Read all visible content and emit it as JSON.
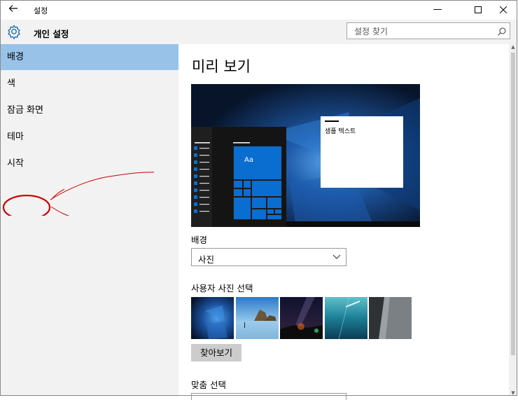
{
  "window": {
    "title": "설정",
    "controls": {
      "minimize": "—",
      "maximize": "☐",
      "close": "✕"
    }
  },
  "header": {
    "section_title": "개인 설정",
    "search_placeholder": "설정 찾기"
  },
  "sidebar": {
    "items": [
      {
        "label": "배경",
        "active": true
      },
      {
        "label": "색",
        "active": false
      },
      {
        "label": "잠금 화면",
        "active": false
      },
      {
        "label": "테마",
        "active": false
      },
      {
        "label": "시작",
        "active": false
      }
    ],
    "highlight_color": "#99c2e8",
    "annotation_color": "#d00000"
  },
  "main": {
    "preview_title": "미리 보기",
    "preview": {
      "sample_text": "샘플 텍스트",
      "tile_label": "Aa",
      "accent_color": "#0a6ed1"
    },
    "background_label": "배경",
    "background_value": "사진",
    "pictures_label": "사용자 사진 선택",
    "browse_button": "찾아보기",
    "fit_label": "맞춤 선택"
  }
}
